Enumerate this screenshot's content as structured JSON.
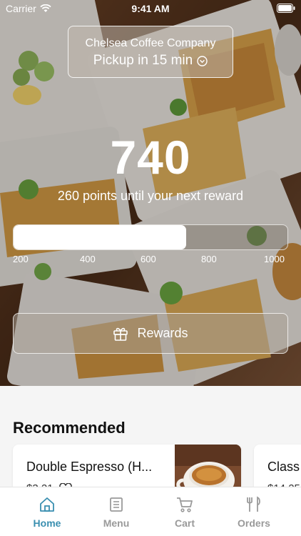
{
  "status_bar": {
    "carrier": "Carrier",
    "time": "9:41 AM"
  },
  "store": {
    "name": "Chelsea Coffee Company",
    "pickup": "Pickup in 15 min"
  },
  "points": {
    "value": "740",
    "caption": "260 points until your next reward",
    "progress_fraction": 0.63,
    "ticks": [
      "200",
      "400",
      "600",
      "800",
      "1000"
    ]
  },
  "rewards_button": {
    "label": "Rewards"
  },
  "recommended": {
    "title": "Recommended",
    "items": [
      {
        "name": "Double Espresso (H...",
        "price": "$3.21"
      },
      {
        "name": "Class",
        "price": "$14.25"
      }
    ]
  },
  "tabs": [
    {
      "label": "Home",
      "icon": "home-icon",
      "active": true
    },
    {
      "label": "Menu",
      "icon": "menu-icon",
      "active": false
    },
    {
      "label": "Cart",
      "icon": "cart-icon",
      "active": false
    },
    {
      "label": "Orders",
      "icon": "orders-icon",
      "active": false
    }
  ],
  "colors": {
    "accent": "#3a8fb0",
    "inactive_tab": "#9a9a9a"
  }
}
